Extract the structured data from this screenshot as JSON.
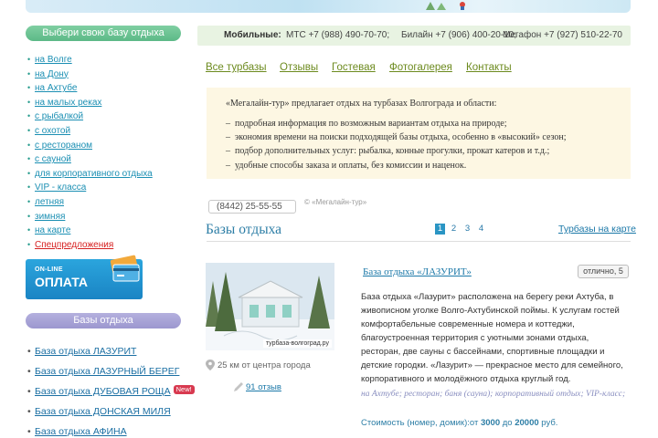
{
  "sidebar": {
    "choose_title": "Выбери свою базу отдыха",
    "categories": [
      {
        "label": "на Волге",
        "highlight": false
      },
      {
        "label": "на Дону",
        "highlight": false
      },
      {
        "label": "на Ахтубе",
        "highlight": false
      },
      {
        "label": "на малых реках",
        "highlight": false
      },
      {
        "label": "с рыбалкой",
        "highlight": false
      },
      {
        "label": "с охотой",
        "highlight": false
      },
      {
        "label": "с рестораном",
        "highlight": false
      },
      {
        "label": "с сауной",
        "highlight": false
      },
      {
        "label": "для корпоративного отдыха",
        "highlight": false
      },
      {
        "label": "VIP - класса",
        "highlight": false
      },
      {
        "label": "летняя",
        "highlight": false
      },
      {
        "label": "зимняя",
        "highlight": false
      },
      {
        "label": "на карте",
        "highlight": false
      },
      {
        "label": "Спецпредложения",
        "highlight": true
      }
    ],
    "payment": {
      "online": "ON-LINE",
      "label": "ОПЛАТА"
    },
    "bases_title": "Базы отдыха",
    "bases": [
      {
        "label": "База отдыха ЛАЗУРИТ",
        "badge": ""
      },
      {
        "label": "База отдыха ЛАЗУРНЫЙ БЕРЕГ",
        "badge": ""
      },
      {
        "label": "База отдыха ДУБОВАЯ РОЩА",
        "badge": "New!"
      },
      {
        "label": "База отдыха ДОНСКАЯ МИЛЯ",
        "badge": ""
      },
      {
        "label": "База отдыха АФИНА",
        "badge": ""
      }
    ]
  },
  "phones": {
    "label": "Мобильные:",
    "items": [
      "МТС +7 (988) 490-70-70;",
      "Билайн +7 (906) 400-20-10;",
      "Мегафон +7 (927) 510-22-70"
    ]
  },
  "nav": [
    "Все турбазы",
    "Отзывы",
    "Гостевая",
    "Фотогалерея",
    "Контакты"
  ],
  "intro": {
    "lead": "«Мегалайн-тур» предлагает отдых на турбазах Волгограда и области:",
    "bullets": [
      "подробная информация по возможным вариантам отдыха на природе;",
      "экономия времени на поиски подходящей базы отдыха, особенно в «высокий» сезон;",
      "подбор дополнительных услуг: рыбалка, конные прогулки, прокат катеров и т.д.;",
      "удобные способы заказа и оплаты, без комиссии и наценок."
    ]
  },
  "contact": {
    "phone": "(8442) 25-55-55",
    "copyright": "© «Мегалайн-тур»"
  },
  "section": {
    "title": "Базы отдыха",
    "pages": [
      "1",
      "2",
      "3",
      "4"
    ],
    "active_page": "1",
    "map_link": "Турбазы на карте"
  },
  "card": {
    "photo_caption": "турбаза-волгоград.ру",
    "distance": "25 км от центра города",
    "reviews": "91 отзыв",
    "title": "База отдыха «ЛАЗУРИТ»",
    "rating": "отлично, 5",
    "description": "База отдыха «Лазурит» расположена на берегу реки Ахтуба, в живописном уголке Волго-Ахтубинской поймы. К услугам гостей комфортабельные современные номера и коттеджи, благоустроенная территория с уютными зонами отдыха, ресторан, две сауны с бассейнами, спортивные площадки и детские городки. «Лазурит» — прекрасное место для семейного, корпоративного и молодёжного отдыха круглый год.",
    "tags": "на Ахтубе; ресторан; баня (сауна); корпоративный отдых; VIP-класс;",
    "price_prefix": "Стоимость (номер, домик):от ",
    "price_from": "3000",
    "price_mid": " до ",
    "price_to": "20000",
    "price_suffix": " руб."
  },
  "colors": {
    "accent_green": "#6c8a1e",
    "link_blue": "#1b78a8",
    "pill_green": "#5cb987",
    "pill_purple": "#9c97cf"
  }
}
